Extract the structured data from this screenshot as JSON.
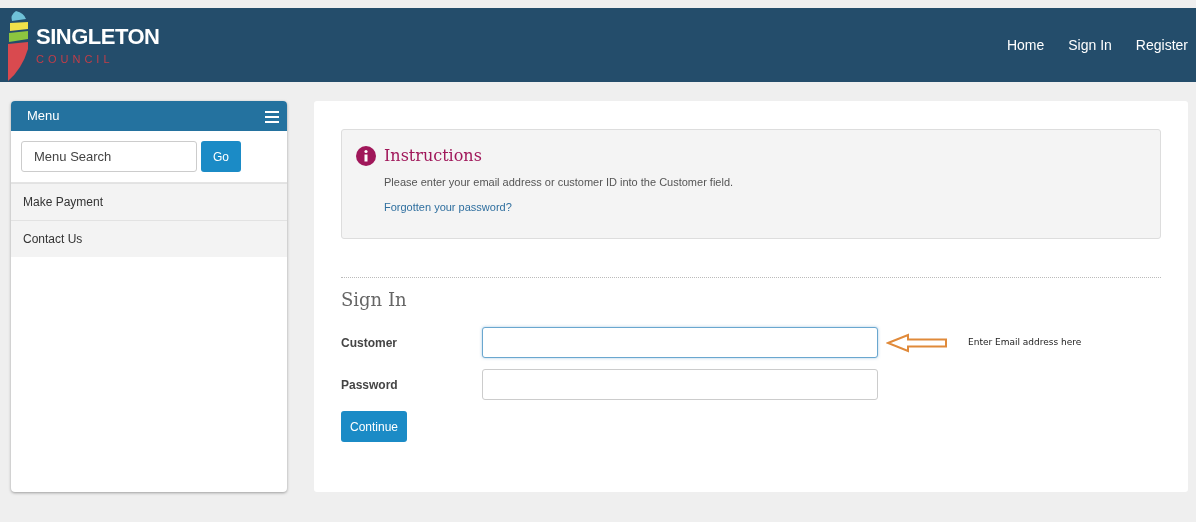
{
  "header": {
    "logo_title": "SINGLETON",
    "logo_subtitle": "COUNCIL",
    "nav": [
      {
        "label": "Home"
      },
      {
        "label": "Sign In"
      },
      {
        "label": "Register"
      }
    ]
  },
  "menu": {
    "title": "Menu",
    "search": {
      "placeholder": "Menu Search"
    },
    "go_button": "Go",
    "items": [
      {
        "label": "Make Payment"
      },
      {
        "label": "Contact Us"
      }
    ]
  },
  "instructions": {
    "title": "Instructions",
    "text": "Please enter your email address or customer ID into the Customer field.",
    "link": "Forgotten your password?"
  },
  "sign_in": {
    "title": "Sign In",
    "fields": [
      {
        "label": "Customer",
        "focused": true
      },
      {
        "label": "Password",
        "focused": false
      }
    ],
    "button": "Continue"
  },
  "annotation": {
    "text": "Enter Email address here"
  }
}
